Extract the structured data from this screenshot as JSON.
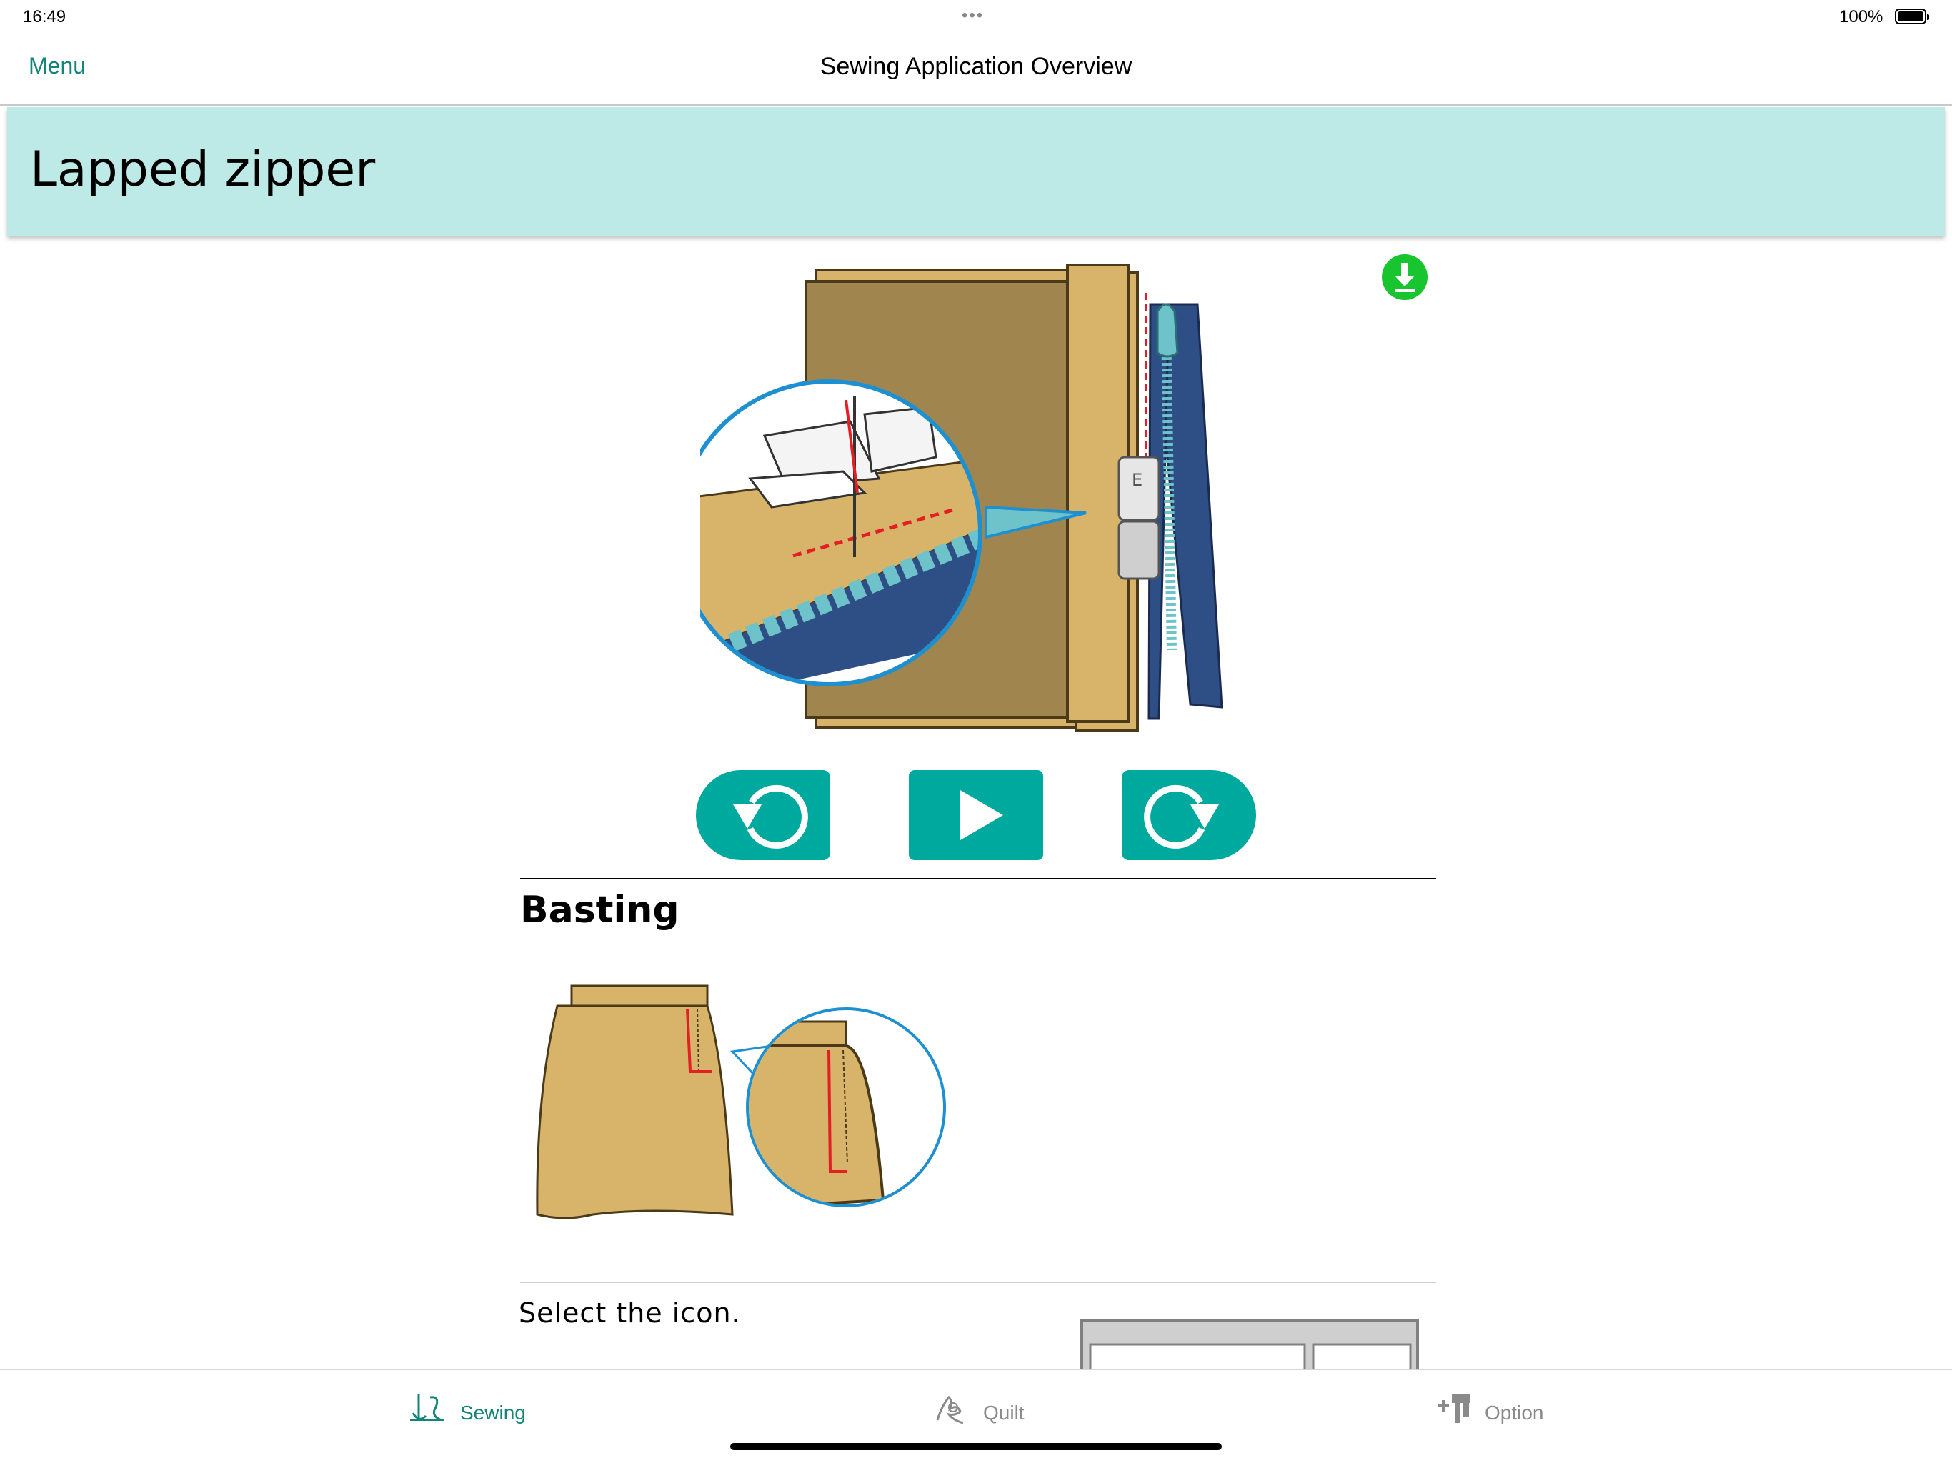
{
  "status_bar": {
    "time": "16:49",
    "dots": "•••",
    "battery_percent": "100%"
  },
  "nav": {
    "menu_label": "Menu",
    "title": "Sewing Application  Overview"
  },
  "page": {
    "title": "Lapped zipper"
  },
  "icons": {
    "download": "download-icon",
    "rewind": "rewind-icon",
    "play": "play-icon",
    "forward": "forward-icon"
  },
  "colors": {
    "accent": "#00a99d",
    "banner": "#bdeae6",
    "menu_text": "#15857a",
    "download_green": "#19c52f",
    "fabric": "#d8b46a",
    "fabric_dark": "#a0864e",
    "zipper_blue": "#2e4f86",
    "zipper_teeth": "#6dc3c9",
    "stitch_red": "#e31e24",
    "circle_border": "#1e90d0"
  },
  "section": {
    "heading": "Basting",
    "instruction": "Select the icon."
  },
  "tabs": [
    {
      "label": "Sewing",
      "icon": "sewing-icon",
      "active": true
    },
    {
      "label": "Quilt",
      "icon": "quilt-icon",
      "active": false
    },
    {
      "label": "Option",
      "icon": "option-icon",
      "active": false
    }
  ]
}
